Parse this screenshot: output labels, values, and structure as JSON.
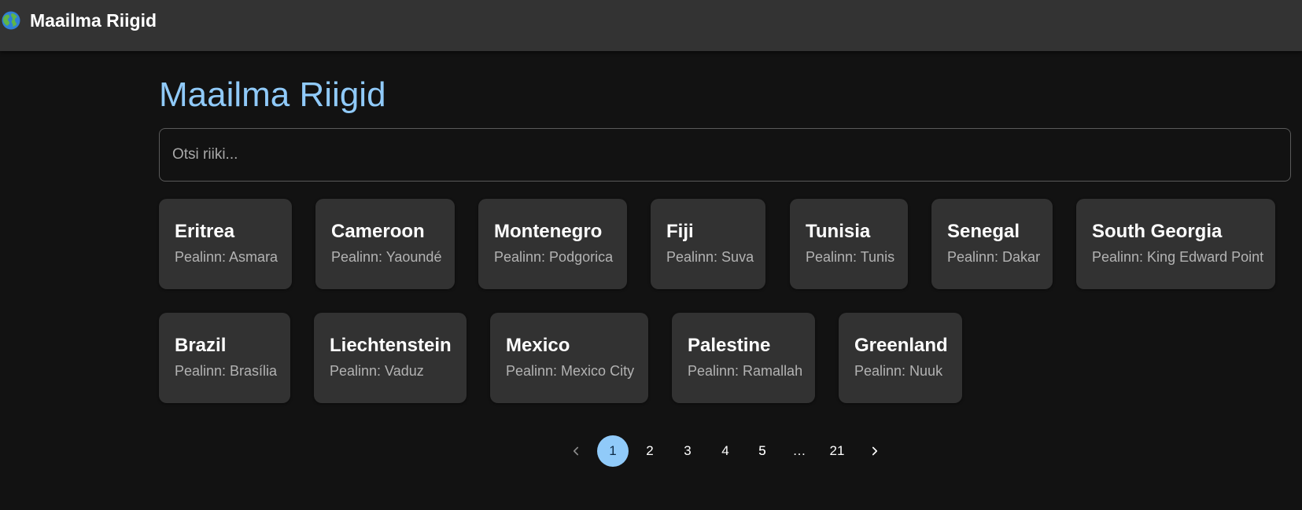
{
  "appbar": {
    "logo_icon": "globe-icon",
    "title": "Maailma Riigid"
  },
  "main": {
    "title": "Maailma Riigid",
    "search": {
      "placeholder": "Otsi riiki...",
      "value": ""
    },
    "countries": [
      {
        "name": "Eritrea",
        "capital": "Pealinn: Asmara"
      },
      {
        "name": "Cameroon",
        "capital": "Pealinn: Yaoundé"
      },
      {
        "name": "Montenegro",
        "capital": "Pealinn: Podgorica"
      },
      {
        "name": "Fiji",
        "capital": "Pealinn: Suva"
      },
      {
        "name": "Tunisia",
        "capital": "Pealinn: Tunis"
      },
      {
        "name": "Senegal",
        "capital": "Pealinn: Dakar"
      },
      {
        "name": "South Georgia",
        "capital": "Pealinn: King Edward Point"
      },
      {
        "name": "Brazil",
        "capital": "Pealinn: Brasília"
      },
      {
        "name": "Liechtenstein",
        "capital": "Pealinn: Vaduz"
      },
      {
        "name": "Mexico",
        "capital": "Pealinn: Mexico City"
      },
      {
        "name": "Palestine",
        "capital": "Pealinn: Ramallah"
      },
      {
        "name": "Greenland",
        "capital": "Pealinn: Nuuk"
      }
    ]
  },
  "pagination": {
    "prev_icon": "chevron-left-icon",
    "next_icon": "chevron-right-icon",
    "pages": [
      "1",
      "2",
      "3",
      "4",
      "5"
    ],
    "ellipsis": "…",
    "last_page": "21",
    "current_page": "1"
  },
  "colors": {
    "accent": "#90caf9",
    "background": "#121212",
    "appbar": "#333333",
    "card": "#323232"
  }
}
